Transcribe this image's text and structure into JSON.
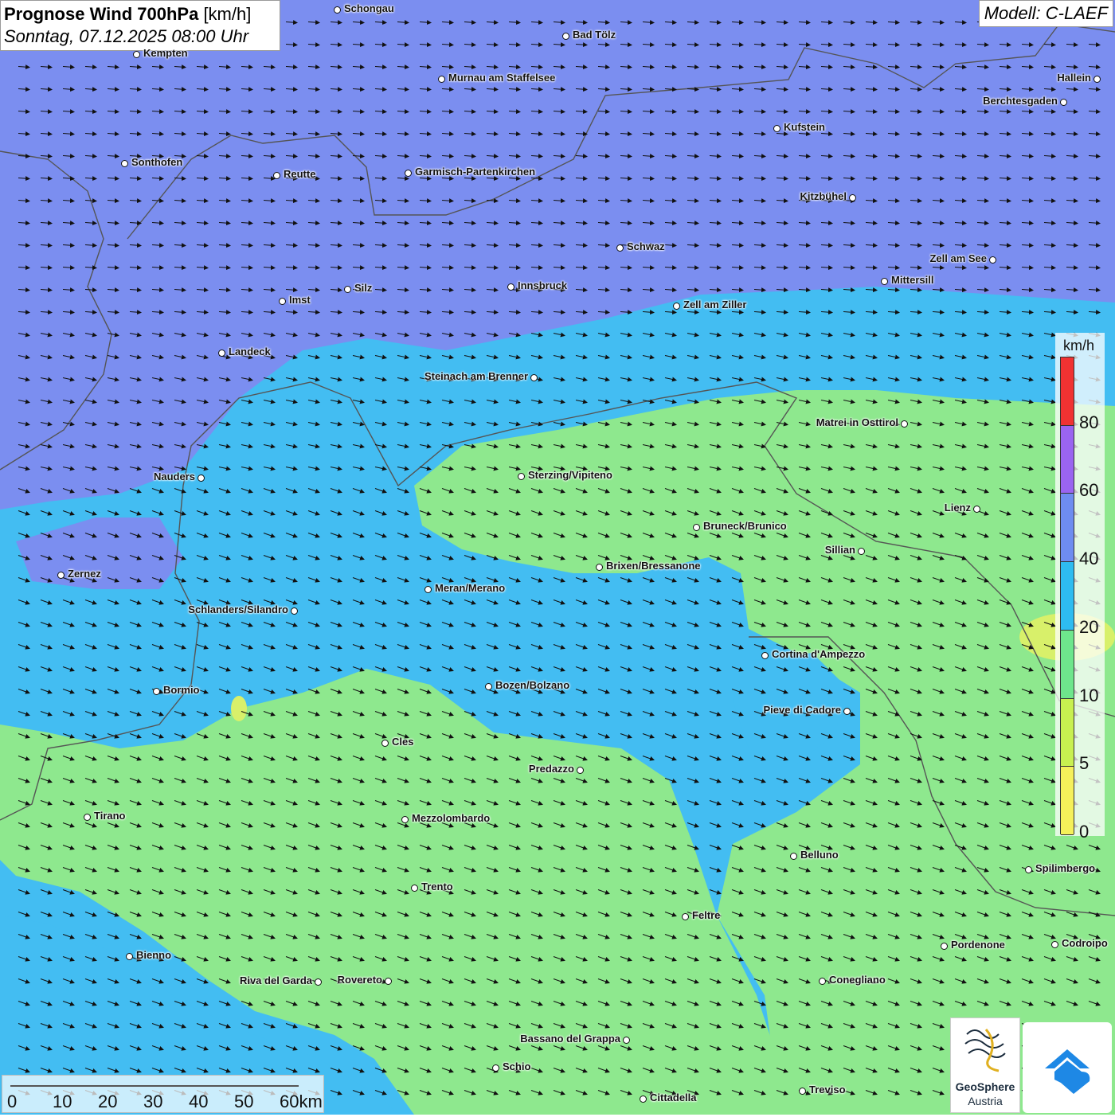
{
  "header": {
    "title_bold": "Prognose Wind 700hPa",
    "title_unit": "[km/h]",
    "datetime": "Sonntag, 07.12.2025 08:00 Uhr",
    "model": "Modell: C-LAEF"
  },
  "legend": {
    "unit": "km/h",
    "ticks": [
      "80",
      "60",
      "40",
      "20",
      "10",
      "5",
      "0"
    ],
    "colors": [
      "#f03232",
      "#9a64f0",
      "#6e8cf0",
      "#2ebcf0",
      "#6ee68c",
      "#c8f050",
      "#f5f05a"
    ]
  },
  "scale": {
    "labels": [
      "0",
      "10",
      "20",
      "30",
      "40",
      "50",
      "60km"
    ]
  },
  "logos": {
    "geosphere_name": "GeoSphere",
    "geosphere_sub": "Austria"
  },
  "map": {
    "colors": {
      "wind_40_60": "#7b8ef0",
      "wind_20_40": "#43bdf2",
      "wind_10_20": "#8ee88e",
      "wind_5_10": "#d8f06a"
    },
    "cities": [
      {
        "name": "Schongau",
        "label_side": "right"
      },
      {
        "name": "Bad Tölz",
        "label_side": "right"
      },
      {
        "name": "Kempten",
        "label_side": "right"
      },
      {
        "name": "Murnau am Staffelsee",
        "label_side": "right"
      },
      {
        "name": "Hallein",
        "label_side": "left"
      },
      {
        "name": "Berchtesgaden",
        "label_side": "left"
      },
      {
        "name": "Kufstein",
        "label_side": "right"
      },
      {
        "name": "Sonthofen",
        "label_side": "right"
      },
      {
        "name": "Reutte",
        "label_side": "right"
      },
      {
        "name": "Garmisch-Partenkirchen",
        "label_side": "right"
      },
      {
        "name": "Kitzbühel",
        "label_side": "left"
      },
      {
        "name": "Schwaz",
        "label_side": "right"
      },
      {
        "name": "Zell am See",
        "label_side": "left"
      },
      {
        "name": "Mittersill",
        "label_side": "right"
      },
      {
        "name": "Imst",
        "label_side": "right"
      },
      {
        "name": "Silz",
        "label_side": "right"
      },
      {
        "name": "Innsbruck",
        "label_side": "right"
      },
      {
        "name": "Zell am Ziller",
        "label_side": "right"
      },
      {
        "name": "Landeck",
        "label_side": "right"
      },
      {
        "name": "Steinach am Brenner",
        "label_side": "left"
      },
      {
        "name": "Matrei in Osttirol",
        "label_side": "left"
      },
      {
        "name": "Nauders",
        "label_side": "left"
      },
      {
        "name": "Sterzing/Vipiteno",
        "label_side": "right"
      },
      {
        "name": "Lienz",
        "label_side": "left"
      },
      {
        "name": "Bruneck/Brunico",
        "label_side": "right"
      },
      {
        "name": "Sillian",
        "label_side": "left"
      },
      {
        "name": "Brixen/Bressanone",
        "label_side": "right"
      },
      {
        "name": "Zernez",
        "label_side": "right"
      },
      {
        "name": "Meran/Merano",
        "label_side": "right"
      },
      {
        "name": "Schlanders/Silandro",
        "label_side": "left"
      },
      {
        "name": "Cortina d'Ampezzo",
        "label_side": "right"
      },
      {
        "name": "Bozen/Bolzano",
        "label_side": "right"
      },
      {
        "name": "Bormio",
        "label_side": "right"
      },
      {
        "name": "Pieve di Cadore",
        "label_side": "left"
      },
      {
        "name": "Cles",
        "label_side": "right"
      },
      {
        "name": "Predazzo",
        "label_side": "left"
      },
      {
        "name": "Tirano",
        "label_side": "right"
      },
      {
        "name": "Mezzolombardo",
        "label_side": "right"
      },
      {
        "name": "Belluno",
        "label_side": "right"
      },
      {
        "name": "Spilimbergo",
        "label_side": "right"
      },
      {
        "name": "Trento",
        "label_side": "right"
      },
      {
        "name": "Feltre",
        "label_side": "right"
      },
      {
        "name": "Pordenone",
        "label_side": "right"
      },
      {
        "name": "Codroipo",
        "label_side": "right"
      },
      {
        "name": "Bienno",
        "label_side": "right"
      },
      {
        "name": "Riva del Garda",
        "label_side": "left"
      },
      {
        "name": "Rovereto",
        "label_side": "left"
      },
      {
        "name": "Conegliano",
        "label_side": "right"
      },
      {
        "name": "Bassano del Grappa",
        "label_side": "left"
      },
      {
        "name": "Schio",
        "label_side": "right"
      },
      {
        "name": "Treviso",
        "label_side": "right"
      },
      {
        "name": "Cittadella",
        "label_side": "right"
      }
    ]
  }
}
